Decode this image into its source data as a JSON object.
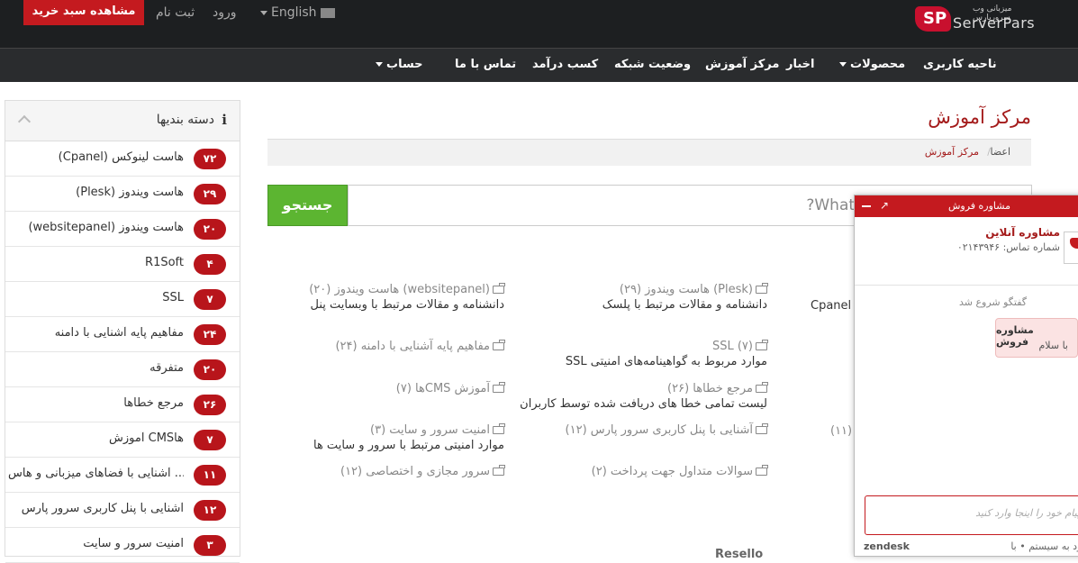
{
  "topbar": {
    "logo_text": "ServerPars",
    "logo_sub": "میزبانی وب سرورپارس",
    "language": "English",
    "login": "ورود",
    "register": "ثبت نام",
    "cart_button": "مشاهده سبد خرید"
  },
  "nav": {
    "items": [
      "ناحیه کاربری",
      "محصولات",
      "اخبار",
      "مرکز آموزش",
      "وضعیت شبکه",
      "کسب درآمد",
      "تماس با ما",
      "حساب"
    ]
  },
  "sidebar": {
    "title": "دسته بندیها",
    "items": [
      {
        "label": "(Cpanel) هاست لینوکس",
        "count": "۷۲"
      },
      {
        "label": "(Plesk) هاست ویندوز",
        "count": "۲۹"
      },
      {
        "label": "(websitepanel) هاست ویندوز",
        "count": "۲۰"
      },
      {
        "label": "R1Soft",
        "count": "۴"
      },
      {
        "label": "SSL",
        "count": "۷"
      },
      {
        "label": "مفاهیم پایه آشنایی با دامنه",
        "count": "۲۴"
      },
      {
        "label": "متفرقه",
        "count": "۲۰"
      },
      {
        "label": "مرجع خطاها",
        "count": "۲۶"
      },
      {
        "label": "آموزش CMSها",
        "count": "۷"
      },
      {
        "label": "آشنایی با فضاهای میزبانی و هاس ...",
        "count": "۱۱"
      },
      {
        "label": "آشنایی با پنل کاربری سرور پارس",
        "count": "۱۲"
      },
      {
        "label": "امنیت سرور و سایت",
        "count": "۳"
      }
    ]
  },
  "main": {
    "title": "مرکز آموزش",
    "breadcrumb": [
      "اعضا",
      "مرکز آموزش"
    ],
    "search_placeholder": "What can we help you with?",
    "search_button": "جستجو",
    "categories": [
      {
        "title": "(Plesk) هاست ویندوز (۲۹)",
        "desc": "دانشنامه و مقالات مرتبط با پلسک"
      },
      {
        "title": "(websitepanel) هاست ویندوز (۲۰)",
        "desc": "دانشنامه و مقالات مرتبط با وبسایت پنل"
      },
      {
        "title": "SSL (۷)",
        "desc": "موارد مربوط به گواهینامه‌های امنیتی SSL"
      },
      {
        "title": "مفاهیم پایه آشنایی با دامنه (۲۴)",
        "desc": ""
      },
      {
        "title": "مرجع خطاها (۲۶)",
        "desc": "لیست تمامی خطا های دریافت شده توسط کاربران"
      },
      {
        "title": "آموزش CMSها (۷)",
        "desc": ""
      },
      {
        "title": "آشنایی با پنل کاربری سرور پارس (۱۲)",
        "desc": ""
      },
      {
        "title": "امنیت سرور و سایت (۳)",
        "desc": "موارد امنیتی مرتبط با سرور و سایت ها"
      },
      {
        "title": "سوالات متداول جهت پرداخت (۲)",
        "desc": ""
      },
      {
        "title": "سرور مجازی و اختصاصی (۱۲)",
        "desc": ""
      }
    ],
    "frag_cpanel": "Cpanel -",
    "frag_11": "(۱۱)",
    "frag_bottom": "Resello"
  },
  "chat": {
    "header": "مشاوره فروش",
    "agent_name": "مشاوره آنلاین",
    "agent_phone": "شماره تماس: ۰۲۱۴۳۹۴۶",
    "started": "گفتگو شروع شد",
    "bubble_name": "مشاوره فروش",
    "bubble_text": "با سلام",
    "compose_placeholder": "پیام خود را اینجا وارد کنید",
    "brand": "zendesk",
    "login": "ورود به سیستم"
  }
}
